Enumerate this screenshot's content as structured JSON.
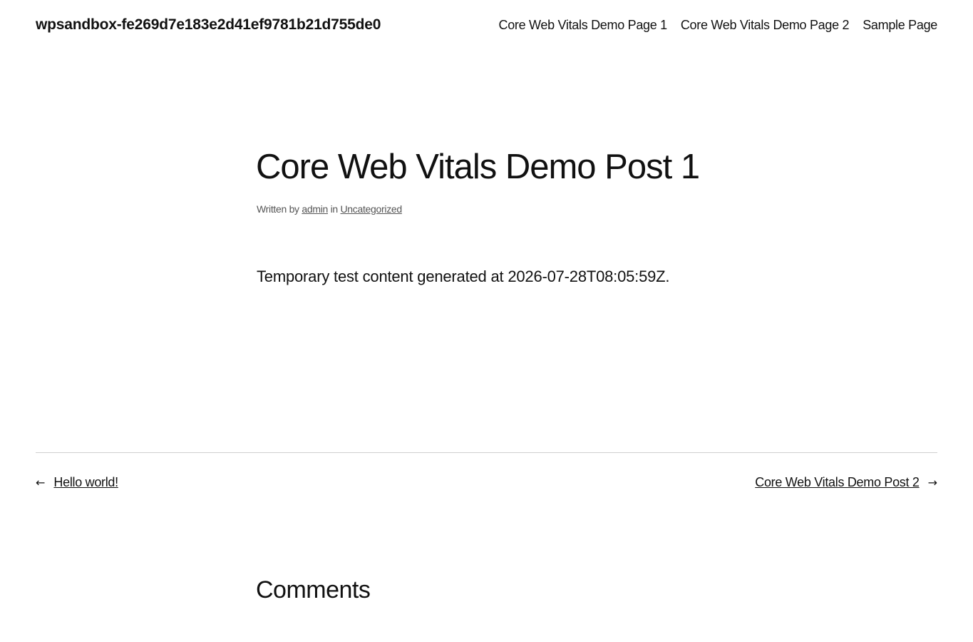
{
  "site": {
    "title": "wpsandbox-fe269d7e183e2d41ef9781b21d755de0"
  },
  "nav": {
    "items": [
      {
        "label": "Core Web Vitals Demo Page 1"
      },
      {
        "label": "Core Web Vitals Demo Page 2"
      },
      {
        "label": "Sample Page"
      }
    ]
  },
  "post": {
    "title": "Core Web Vitals Demo Post 1",
    "meta": {
      "written_by": "Written by",
      "author": "admin",
      "in": "in",
      "category": "Uncategorized"
    },
    "content": "Temporary test content generated at 2026-07-28T08:05:59Z."
  },
  "post_navigation": {
    "previous": {
      "arrow": "←",
      "label": "Hello world!"
    },
    "next": {
      "arrow": "→",
      "label": "Core Web Vitals Demo Post 2"
    }
  },
  "comments": {
    "title": "Comments"
  }
}
